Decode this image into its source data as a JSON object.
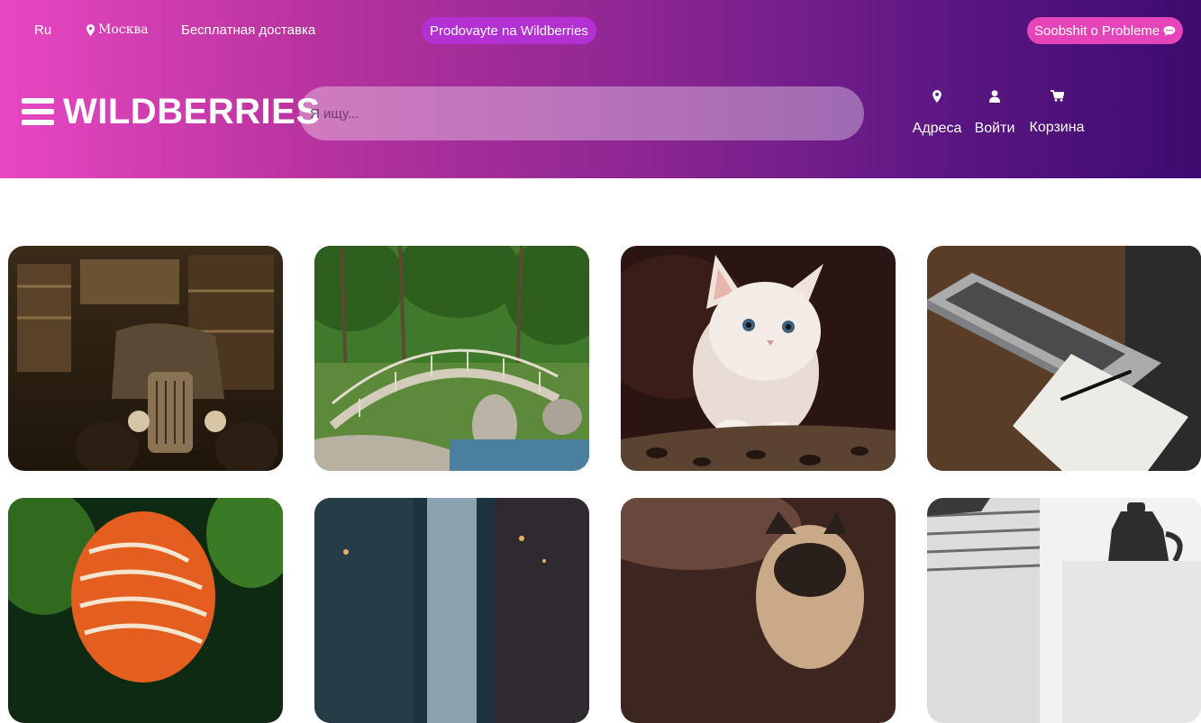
{
  "topbar": {
    "language": "Ru",
    "city": "Москва",
    "delivery": "Бесплатная доставка",
    "seller_link": "Prodovayte na Wildberries",
    "report_link": "Soobshit o Probleme"
  },
  "header": {
    "logo": "WILDBERRIES",
    "search_placeholder": "Я ищу...",
    "nav": {
      "addresses": "Адреса",
      "login": "Войти",
      "cart": "Корзина"
    }
  },
  "colors": {
    "gradient_start": "#e847c2",
    "gradient_end": "#3d0b6e",
    "seller_pill": "#b331d2",
    "report_pill": "#e545b8"
  },
  "products": [
    {
      "image": "vintage-car-garage-photo"
    },
    {
      "image": "garden-bridge-photo"
    },
    {
      "image": "white-kitten-photo"
    },
    {
      "image": "laptop-notebook-photo"
    },
    {
      "image": "tropical-fish-photo"
    },
    {
      "image": "city-street-photo"
    },
    {
      "image": "pug-dog-photo"
    },
    {
      "image": "magazines-coffee-pot-photo"
    }
  ]
}
